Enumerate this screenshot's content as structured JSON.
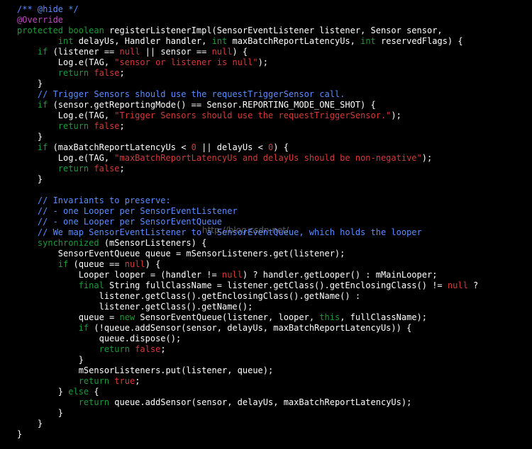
{
  "colors": {
    "background": "#000000",
    "plain": "#ffffff",
    "comment": "#5c8cff",
    "annotation": "#c048c0",
    "keyword": "#1e9a3c",
    "literal": "#d43a3a",
    "string": "#d43a3a"
  },
  "watermark": "http://blog.csdn.net/",
  "code_lines": [
    [
      {
        "t": "c",
        "x": "/** @hide */"
      }
    ],
    [
      {
        "t": "a",
        "x": "@Override"
      }
    ],
    [
      {
        "t": "k",
        "x": "protected boolean"
      },
      {
        "t": "p",
        "x": " registerListenerImpl(SensorEventListener listener, Sensor sensor,"
      }
    ],
    [
      {
        "t": "p",
        "x": "        "
      },
      {
        "t": "k",
        "x": "int"
      },
      {
        "t": "p",
        "x": " delayUs, Handler handler, "
      },
      {
        "t": "k",
        "x": "int"
      },
      {
        "t": "p",
        "x": " maxBatchReportLatencyUs, "
      },
      {
        "t": "k",
        "x": "int"
      },
      {
        "t": "p",
        "x": " reservedFlags) {"
      }
    ],
    [
      {
        "t": "p",
        "x": "    "
      },
      {
        "t": "k",
        "x": "if"
      },
      {
        "t": "p",
        "x": " (listener == "
      },
      {
        "t": "l",
        "x": "null"
      },
      {
        "t": "p",
        "x": " || sensor == "
      },
      {
        "t": "l",
        "x": "null"
      },
      {
        "t": "p",
        "x": ") {"
      }
    ],
    [
      {
        "t": "p",
        "x": "        Log.e(TAG, "
      },
      {
        "t": "s",
        "x": "\"sensor or listener is null\""
      },
      {
        "t": "p",
        "x": ");"
      }
    ],
    [
      {
        "t": "p",
        "x": "        "
      },
      {
        "t": "k",
        "x": "return"
      },
      {
        "t": "p",
        "x": " "
      },
      {
        "t": "l",
        "x": "false"
      },
      {
        "t": "p",
        "x": ";"
      }
    ],
    [
      {
        "t": "p",
        "x": "    }"
      }
    ],
    [
      {
        "t": "p",
        "x": "    "
      },
      {
        "t": "c",
        "x": "// Trigger Sensors should use the requestTriggerSensor call."
      }
    ],
    [
      {
        "t": "p",
        "x": "    "
      },
      {
        "t": "k",
        "x": "if"
      },
      {
        "t": "p",
        "x": " (sensor.getReportingMode() == Sensor.REPORTING_MODE_ONE_SHOT) {"
      }
    ],
    [
      {
        "t": "p",
        "x": "        Log.e(TAG, "
      },
      {
        "t": "s",
        "x": "\"Trigger Sensors should use the requestTriggerSensor.\""
      },
      {
        "t": "p",
        "x": ");"
      }
    ],
    [
      {
        "t": "p",
        "x": "        "
      },
      {
        "t": "k",
        "x": "return"
      },
      {
        "t": "p",
        "x": " "
      },
      {
        "t": "l",
        "x": "false"
      },
      {
        "t": "p",
        "x": ";"
      }
    ],
    [
      {
        "t": "p",
        "x": "    }"
      }
    ],
    [
      {
        "t": "p",
        "x": "    "
      },
      {
        "t": "k",
        "x": "if"
      },
      {
        "t": "p",
        "x": " (maxBatchReportLatencyUs < "
      },
      {
        "t": "l",
        "x": "0"
      },
      {
        "t": "p",
        "x": " || delayUs < "
      },
      {
        "t": "l",
        "x": "0"
      },
      {
        "t": "p",
        "x": ") {"
      }
    ],
    [
      {
        "t": "p",
        "x": "        Log.e(TAG, "
      },
      {
        "t": "s",
        "x": "\"maxBatchReportLatencyUs and delayUs should be non-negative\""
      },
      {
        "t": "p",
        "x": ");"
      }
    ],
    [
      {
        "t": "p",
        "x": "        "
      },
      {
        "t": "k",
        "x": "return"
      },
      {
        "t": "p",
        "x": " "
      },
      {
        "t": "l",
        "x": "false"
      },
      {
        "t": "p",
        "x": ";"
      }
    ],
    [
      {
        "t": "p",
        "x": "    }"
      }
    ],
    [
      {
        "t": "p",
        "x": ""
      }
    ],
    [
      {
        "t": "p",
        "x": "    "
      },
      {
        "t": "c",
        "x": "// Invariants to preserve:"
      }
    ],
    [
      {
        "t": "p",
        "x": "    "
      },
      {
        "t": "c",
        "x": "// - one Looper per SensorEventListener"
      }
    ],
    [
      {
        "t": "p",
        "x": "    "
      },
      {
        "t": "c",
        "x": "// - one Looper per SensorEventQueue"
      }
    ],
    [
      {
        "t": "p",
        "x": "    "
      },
      {
        "t": "c",
        "x": "// We map SensorEventListener to a SensorEventQueue, which holds the looper"
      }
    ],
    [
      {
        "t": "p",
        "x": "    "
      },
      {
        "t": "k",
        "x": "synchronized"
      },
      {
        "t": "p",
        "x": " (mSensorListeners) {"
      }
    ],
    [
      {
        "t": "p",
        "x": "        SensorEventQueue queue = mSensorListeners.get(listener);"
      }
    ],
    [
      {
        "t": "p",
        "x": "        "
      },
      {
        "t": "k",
        "x": "if"
      },
      {
        "t": "p",
        "x": " (queue == "
      },
      {
        "t": "l",
        "x": "null"
      },
      {
        "t": "p",
        "x": ") {"
      }
    ],
    [
      {
        "t": "p",
        "x": "            Looper looper = (handler != "
      },
      {
        "t": "l",
        "x": "null"
      },
      {
        "t": "p",
        "x": ") ? handler.getLooper() : mMainLooper;"
      }
    ],
    [
      {
        "t": "p",
        "x": "            "
      },
      {
        "t": "k",
        "x": "final"
      },
      {
        "t": "p",
        "x": " String fullClassName = listener.getClass().getEnclosingClass() != "
      },
      {
        "t": "l",
        "x": "null"
      },
      {
        "t": "p",
        "x": " ?"
      }
    ],
    [
      {
        "t": "p",
        "x": "                listener.getClass().getEnclosingClass().getName() :"
      }
    ],
    [
      {
        "t": "p",
        "x": "                listener.getClass().getName();"
      }
    ],
    [
      {
        "t": "p",
        "x": "            queue = "
      },
      {
        "t": "k",
        "x": "new"
      },
      {
        "t": "p",
        "x": " SensorEventQueue(listener, looper, "
      },
      {
        "t": "k",
        "x": "this"
      },
      {
        "t": "p",
        "x": ", fullClassName);"
      }
    ],
    [
      {
        "t": "p",
        "x": "            "
      },
      {
        "t": "k",
        "x": "if"
      },
      {
        "t": "p",
        "x": " (!queue.addSensor(sensor, delayUs, maxBatchReportLatencyUs)) {"
      }
    ],
    [
      {
        "t": "p",
        "x": "                queue.dispose();"
      }
    ],
    [
      {
        "t": "p",
        "x": "                "
      },
      {
        "t": "k",
        "x": "return"
      },
      {
        "t": "p",
        "x": " "
      },
      {
        "t": "l",
        "x": "false"
      },
      {
        "t": "p",
        "x": ";"
      }
    ],
    [
      {
        "t": "p",
        "x": "            }"
      }
    ],
    [
      {
        "t": "p",
        "x": "            mSensorListeners.put(listener, queue);"
      }
    ],
    [
      {
        "t": "p",
        "x": "            "
      },
      {
        "t": "k",
        "x": "return"
      },
      {
        "t": "p",
        "x": " "
      },
      {
        "t": "l",
        "x": "true"
      },
      {
        "t": "p",
        "x": ";"
      }
    ],
    [
      {
        "t": "p",
        "x": "        } "
      },
      {
        "t": "k",
        "x": "else"
      },
      {
        "t": "p",
        "x": " {"
      }
    ],
    [
      {
        "t": "p",
        "x": "            "
      },
      {
        "t": "k",
        "x": "return"
      },
      {
        "t": "p",
        "x": " queue.addSensor(sensor, delayUs, maxBatchReportLatencyUs);"
      }
    ],
    [
      {
        "t": "p",
        "x": "        }"
      }
    ],
    [
      {
        "t": "p",
        "x": "    }"
      }
    ],
    [
      {
        "t": "p",
        "x": "}"
      }
    ]
  ]
}
